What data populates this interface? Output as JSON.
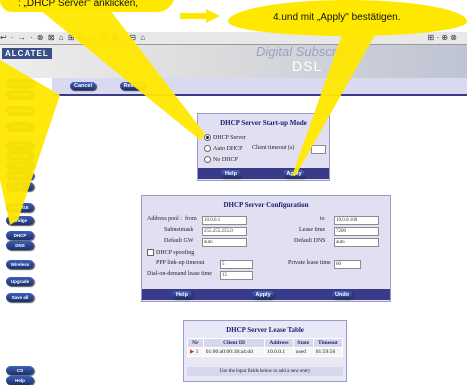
{
  "callouts": {
    "left_text": ": „DHCP Server\" anklicken,",
    "right_text": "4.und mit „Apply\" bestätigen.",
    "color": "#ffe800"
  },
  "toolbar": {
    "left_glyphs": "↩ · → · ⊗ ⊠ ⌂ ⊞ ✉ ⊡ ⊟ ⊠ · ⊟ ⌂",
    "right_glyphs": "⊞ · ⊕ ⊗"
  },
  "header": {
    "logo": "ALCATEL",
    "title": "Digital Subscriber",
    "subtitle": "DSL"
  },
  "sidebar": {
    "items": [
      {
        "label": "Initial Setup"
      },
      {
        "label": "System setup"
      },
      {
        "label": "Phonebook"
      },
      {
        "label": "Dial in"
      },
      {
        "label": "NAT"
      },
      {
        "label": "Routing"
      },
      {
        "label": "RIP"
      },
      {
        "label": "PPP"
      },
      {
        "label": "IP"
      },
      {
        "label": "BRIDGE"
      },
      {
        "label": "Bridge"
      },
      {
        "label": "DHCP"
      },
      {
        "label": "DNS"
      },
      {
        "label": "Wireless"
      },
      {
        "label": "Upgrade"
      },
      {
        "label": "Save all"
      },
      {
        "label": "CS"
      },
      {
        "label": "Help"
      }
    ]
  },
  "topbar": {
    "buttons": [
      "Cancel",
      "Restart"
    ]
  },
  "startup": {
    "title": "DHCP Server Start-up Mode",
    "options": [
      "DHCP Server",
      "Auto DHCP",
      "No DHCP"
    ],
    "selected": "DHCP Server",
    "client_timeout_label": "Client timeout (s)",
    "client_timeout_value": "",
    "buttons": [
      "Help",
      "Apply"
    ]
  },
  "config": {
    "title": "DHCP Server Configuration",
    "address_pool_label": "Address pool :",
    "from_label": "from",
    "from_value": "10.0.0.1",
    "to_label": "to",
    "to_value": "10.0.0.100",
    "subnetmask_label": "Subnetmask",
    "subnetmask_value": "255.255.255.0",
    "lease_time_label": "Lease time",
    "lease_time_value": "7200",
    "default_gw_label": "Default GW",
    "default_gw_value": "auto",
    "default_dns_label": "Default DNS",
    "default_dns_value": "auto",
    "spoofing_label": "DHCP spoofing",
    "ppp_timeout_label": "PPP link-up timeout",
    "ppp_timeout_value": "5",
    "private_lease_label": "Private lease time",
    "private_lease_value": "60",
    "dial_lease_label": "Dial-on-demand lease time",
    "dial_lease_value": "15",
    "buttons": [
      "Help",
      "Apply",
      "Undo"
    ]
  },
  "lease_table": {
    "title": "DHCP Server Lease Table",
    "columns": [
      "Nr",
      "Client ID",
      "Address",
      "State",
      "Timeout"
    ],
    "rows": [
      {
        "nr": "1",
        "client_id": "01:00:a0:00:38:a4:dd",
        "address": "10.0.0.1",
        "state": "used",
        "timeout": "01:59:56"
      }
    ],
    "footer": "Use the input fields below to add a new entry"
  }
}
